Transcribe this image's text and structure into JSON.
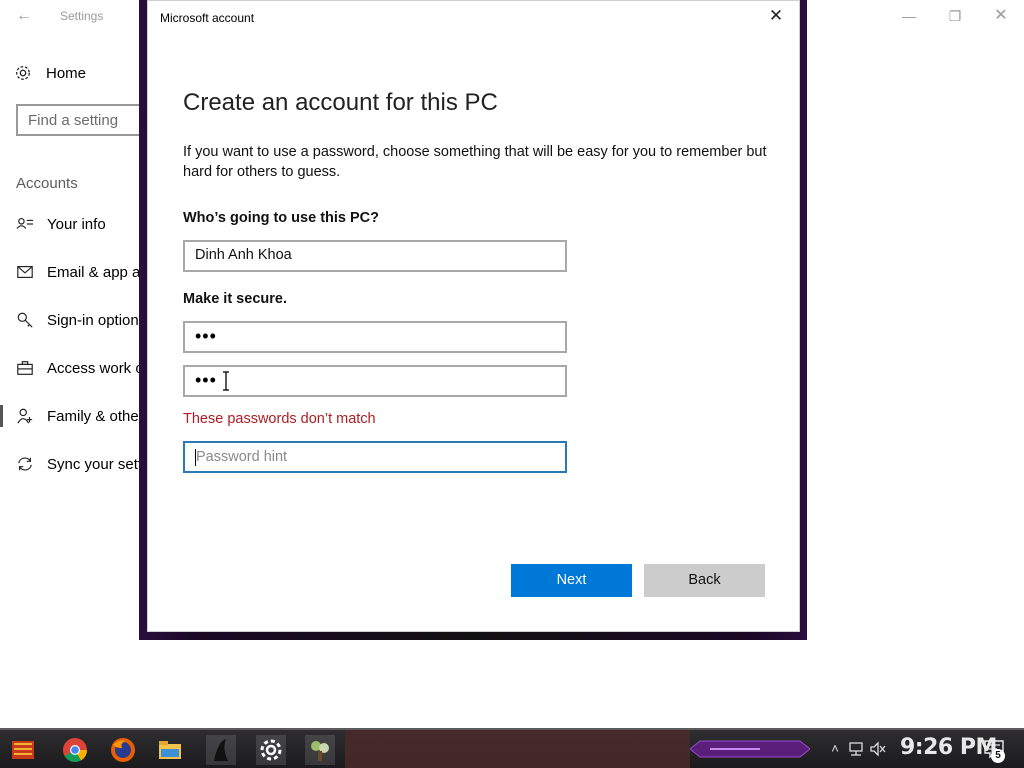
{
  "settings_window": {
    "title": "Settings",
    "home_label": "Home",
    "search_placeholder": "Find a setting",
    "section_title": "Accounts",
    "nav_items": [
      {
        "label": "Your info",
        "icon": "person-card-icon"
      },
      {
        "label": "Email & app a",
        "icon": "mail-icon"
      },
      {
        "label": "Sign-in option",
        "icon": "key-icon"
      },
      {
        "label": "Access work o",
        "icon": "briefcase-icon"
      },
      {
        "label": "Family & othe",
        "icon": "people-icon",
        "selected": true
      },
      {
        "label": "Sync your sett",
        "icon": "sync-icon"
      }
    ]
  },
  "dialog": {
    "title": "Microsoft account",
    "heading": "Create an account for this PC",
    "description": "If you want to use a password, choose something that will be easy for you to remember but hard for others to guess.",
    "who_label": "Who’s going to use this PC?",
    "username_value": "Dinh Anh Khoa",
    "secure_label": "Make it secure.",
    "password_dots": "•••",
    "reenter_dots": "•••",
    "error_text": "These passwords don’t match",
    "hint_placeholder": "Password hint",
    "next_label": "Next",
    "back_label": "Back",
    "colors": {
      "primary_button": "#0078d7",
      "error": "#b01e23",
      "focus_border": "#2a7ab8"
    }
  },
  "taskbar": {
    "apps": [
      "start-icon",
      "chrome-icon",
      "firefox-icon",
      "file-explorer-icon",
      "app-icon",
      "settings-gear-icon",
      "app-icon-2"
    ],
    "clock": "9:26 PM",
    "notification_count": "5"
  }
}
